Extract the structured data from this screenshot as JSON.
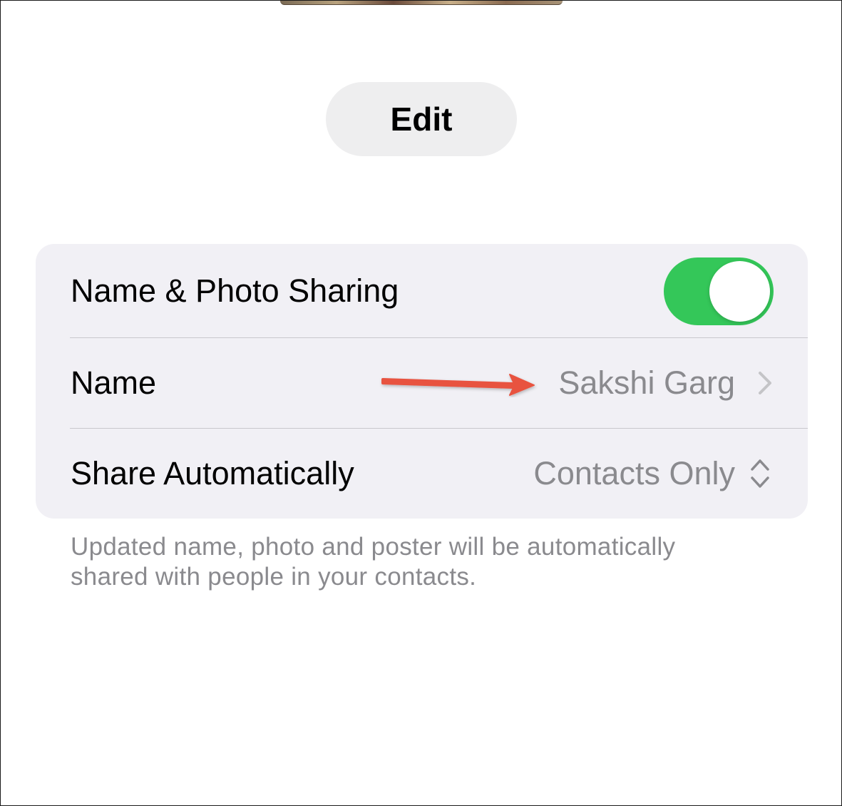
{
  "header": {
    "edit_label": "Edit"
  },
  "settings": {
    "rows": [
      {
        "label": "Name & Photo Sharing",
        "toggle_on": true
      },
      {
        "label": "Name",
        "value": "Sakshi Garg"
      },
      {
        "label": "Share Automatically",
        "value": "Contacts Only"
      }
    ],
    "footer": "Updated name, photo and poster will be automatically shared with people in your contacts."
  },
  "icons": {
    "name_row": "chevron-right-icon",
    "share_row": "chevron-up-down-icon",
    "annotation": "red-arrow-icon"
  },
  "colors": {
    "toggle_on": "#34c759",
    "secondary_text": "#8a8a8e",
    "group_background": "#f1f0f5",
    "button_background": "#eeeeef",
    "annotation_arrow": "#e8533f"
  }
}
